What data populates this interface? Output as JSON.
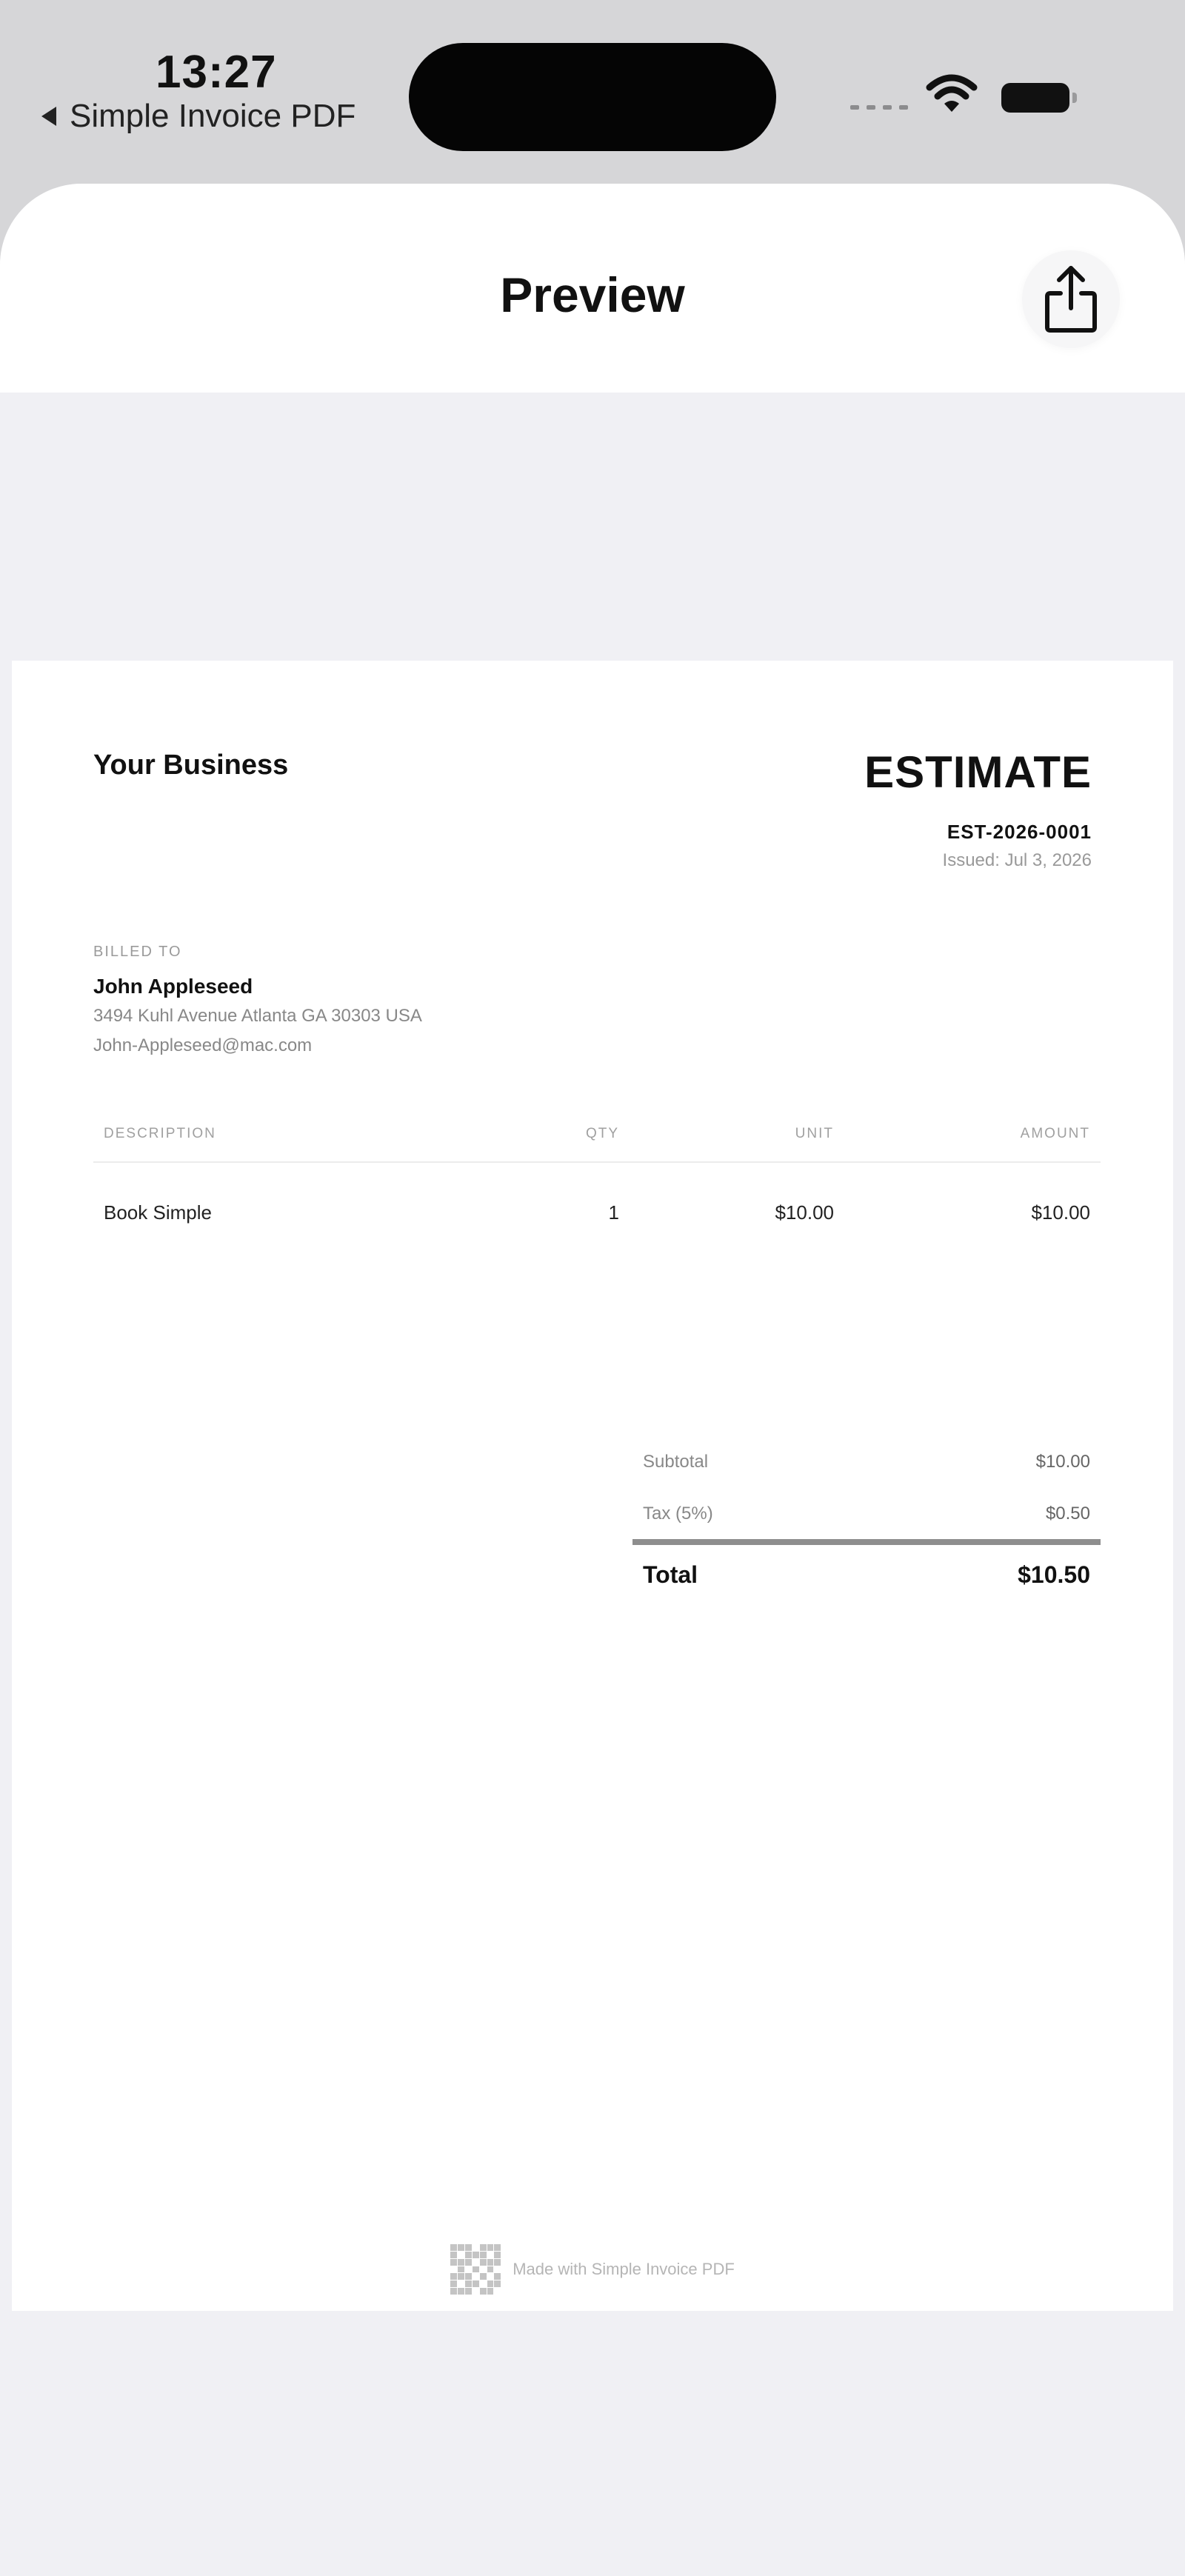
{
  "status_bar": {
    "time": "13:27",
    "back_app": "Simple Invoice PDF"
  },
  "nav": {
    "title": "Preview",
    "share_icon": "share-icon"
  },
  "document": {
    "business_name": "Your Business",
    "type": "ESTIMATE",
    "number": "EST-2026-0001",
    "date": "Issued: Jul 3, 2026",
    "billed_to_label": "BILLED TO",
    "client": {
      "name": "John Appleseed",
      "address": "3494 Kuhl Avenue Atlanta GA 30303 USA",
      "email": "John-Appleseed@mac.com"
    },
    "table": {
      "headers": [
        "DESCRIPTION",
        "QTY",
        "UNIT",
        "AMOUNT"
      ],
      "rows": [
        {
          "description": "Book Simple",
          "qty": "1",
          "unit": "$10.00",
          "amount": "$10.00"
        }
      ]
    },
    "totals": {
      "subtotal_label": "Subtotal",
      "subtotal_value": "$10.00",
      "tax_label": "Tax (5%)",
      "tax_value": "$0.50",
      "total_label": "Total",
      "total_value": "$10.50"
    },
    "footer_text": "Made with Simple Invoice PDF"
  }
}
